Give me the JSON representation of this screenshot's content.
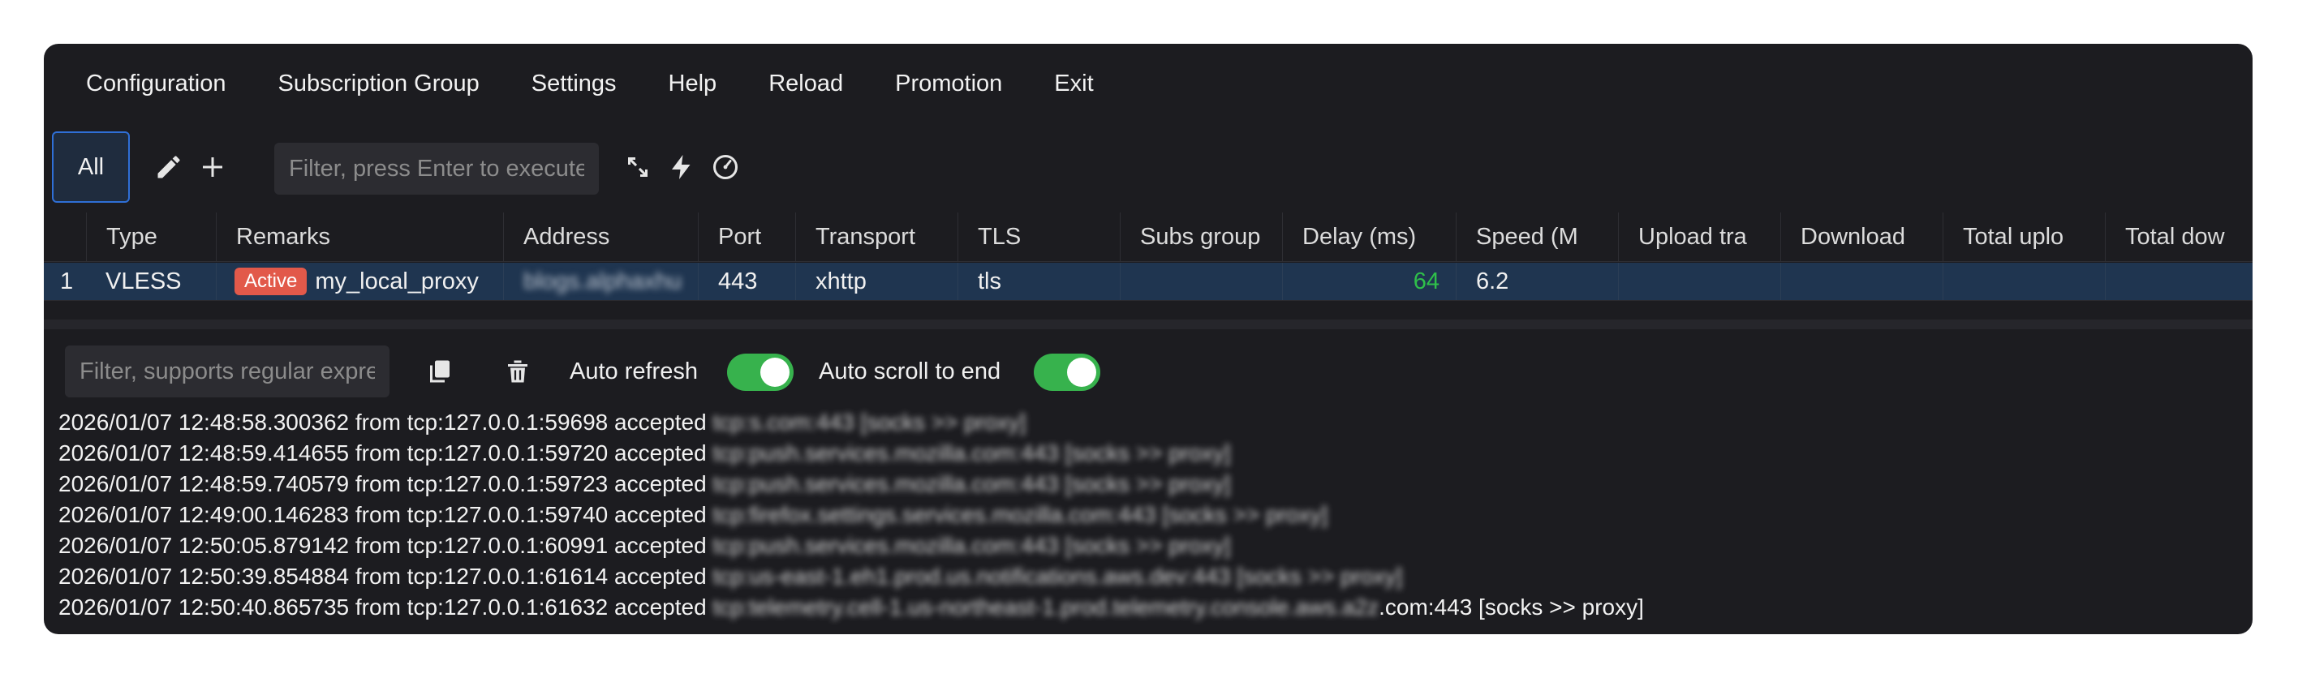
{
  "menu": [
    "Configuration",
    "Subscription Group",
    "Settings",
    "Help",
    "Reload",
    "Promotion",
    "Exit"
  ],
  "toolbar": {
    "all_label": "All",
    "filter_placeholder": "Filter, press Enter to execute",
    "icons": [
      "edit-icon",
      "add-icon",
      "expand-icon",
      "flash-icon",
      "speedometer-icon"
    ]
  },
  "table": {
    "columns": [
      "Type",
      "Remarks",
      "Address",
      "Port",
      "Transport",
      "TLS",
      "Subs group",
      "Delay (ms)",
      "Speed (M",
      "Upload tra",
      "Download",
      "Total uplo",
      "Total dow"
    ],
    "rows": [
      {
        "index": "1",
        "type": "VLESS",
        "badge": "Active",
        "remarks": "my_local_proxy",
        "address": "blogs.alphaxhu",
        "port": "443",
        "transport": "xhttp",
        "tls": "tls",
        "subs_group": "",
        "delay": "64",
        "speed": "6.2"
      }
    ]
  },
  "log_toolbar": {
    "filter_placeholder": "Filter, supports regular expression",
    "auto_refresh_label": "Auto refresh",
    "auto_refresh_on": true,
    "auto_scroll_label": "Auto scroll to end",
    "auto_scroll_on": true
  },
  "log": [
    {
      "time": "2026/01/07 12:48:58.300362",
      "from": "from tcp:127.0.0.1:59698 accepted",
      "target": "tcp:s.com:443 [socks >> proxy]",
      "tail": ""
    },
    {
      "time": "2026/01/07 12:48:59.414655",
      "from": "from tcp:127.0.0.1:59720 accepted",
      "target": "tcp:push.services.mozilla.com:443 [socks >> proxy]",
      "tail": ""
    },
    {
      "time": "2026/01/07 12:48:59.740579",
      "from": "from tcp:127.0.0.1:59723 accepted",
      "target": "tcp:push.services.mozilla.com:443 [socks >> proxy]",
      "tail": ""
    },
    {
      "time": "2026/01/07 12:49:00.146283",
      "from": "from tcp:127.0.0.1:59740 accepted",
      "target": "tcp:firefox.settings.services.mozilla.com:443 [socks >> proxy]",
      "tail": ""
    },
    {
      "time": "2026/01/07 12:50:05.879142",
      "from": "from tcp:127.0.0.1:60991 accepted",
      "target": "tcp:push.services.mozilla.com:443 [socks >> proxy]",
      "tail": ""
    },
    {
      "time": "2026/01/07 12:50:39.854884",
      "from": "from tcp:127.0.0.1:61614 accepted",
      "target": "tcp:us-east-1.eh1.prod.us.notifications.aws.dev:443 [socks >> proxy]",
      "tail": ""
    },
    {
      "time": "2026/01/07 12:50:40.865735",
      "from": "from tcp:127.0.0.1:61632 accepted",
      "target": "tcp:telemetry.cell-1.us-northeast-1.prod.telemetry.console.aws.a2z",
      "tail": ".com:443 [socks >> proxy]"
    }
  ],
  "colors": {
    "window_bg": "#1c1c20",
    "selected_row": "#1f3550",
    "accent": "#2f6fd6",
    "badge": "#e2594a",
    "toggle_on": "#37b24d",
    "delay_good": "#2fbf4a"
  }
}
